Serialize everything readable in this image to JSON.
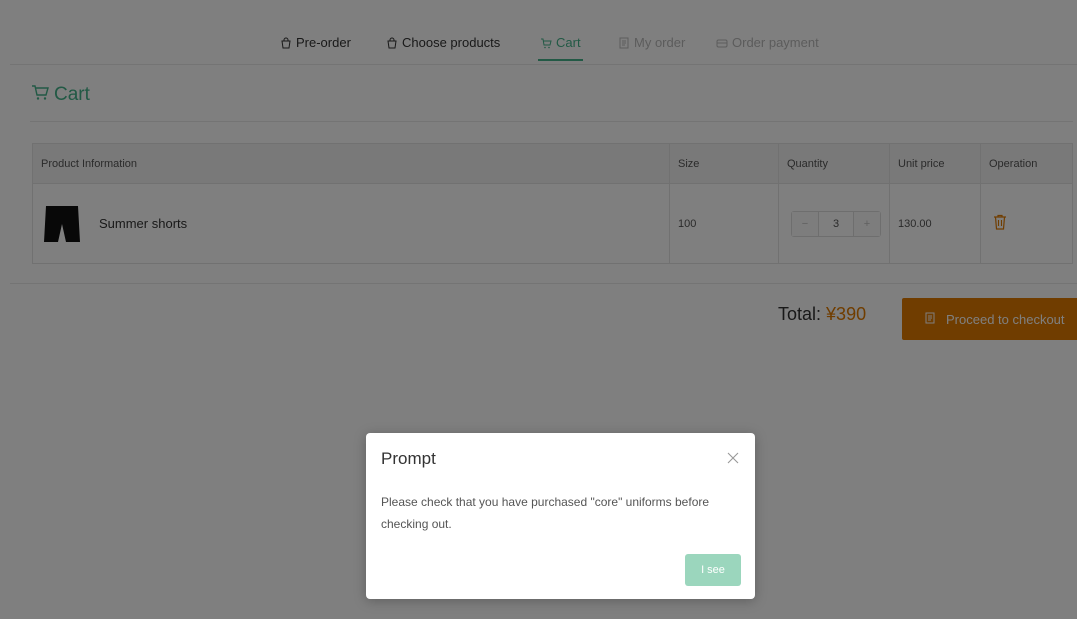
{
  "nav": {
    "items": [
      {
        "label": "Pre-order",
        "icon": "bag-icon"
      },
      {
        "label": "Choose products",
        "icon": "bag-icon"
      },
      {
        "label": "Cart",
        "icon": "cart-icon"
      },
      {
        "label": "My order",
        "icon": "document-icon"
      },
      {
        "label": "Order payment",
        "icon": "wallet-icon"
      }
    ],
    "active_tab": "Cart"
  },
  "cart": {
    "title": "Cart",
    "table": {
      "headers": [
        "Product Information",
        "Size",
        "Quantity",
        "Unit price",
        "Operation"
      ],
      "rows": [
        {
          "product": "Summer shorts",
          "size": "100",
          "quantity": "3",
          "unit_price": "130.00"
        }
      ]
    },
    "stepper": {
      "minus": "−",
      "plus": "+"
    }
  },
  "summary": {
    "total_label": "Total:",
    "total_amount": "¥390",
    "checkout_label": "Proceed to checkout"
  },
  "modal": {
    "title": "Prompt",
    "message": "Please check that you have purchased \"core\" uniforms before checking out.",
    "button_label": "I see"
  },
  "colors": {
    "accent_green": "#45b38a",
    "accent_orange": "#e07b00",
    "modal_button": "#9bd6bd"
  }
}
